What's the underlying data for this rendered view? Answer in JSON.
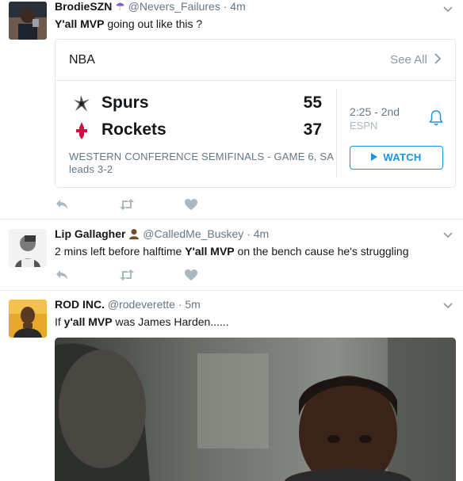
{
  "tweets": [
    {
      "fullname": "BrodieSZN",
      "name_emoji": "☂",
      "username": "@Nevers_Failures",
      "dot": "·",
      "time": "4m",
      "text_bold": "Y'all MVP",
      "text_rest": " going out like this ?"
    },
    {
      "fullname": "Lip Gallagher",
      "username": "@CalledMe_Buskey",
      "dot": "·",
      "time": "4m",
      "text_pre": "2 mins left before halftime ",
      "text_bold": "Y'all MVP",
      "text_rest": " on the bench cause he's struggling"
    },
    {
      "fullname": "ROD INC.",
      "username": "@rodeverette",
      "dot": "·",
      "time": "5m",
      "text_pre": "If ",
      "text_bold": "y'all MVP",
      "text_rest": " was James Harden......"
    }
  ],
  "score_card": {
    "league": "NBA",
    "see_all": "See All",
    "teams": [
      {
        "name": "Spurs",
        "score": "55"
      },
      {
        "name": "Rockets",
        "score": "37"
      }
    ],
    "series": "WESTERN CONFERENCE SEMIFINALS - GAME 6, SA leads 3-2",
    "clock": "2:25 - 2nd",
    "network": "ESPN",
    "watch_label": "WATCH"
  },
  "colors": {
    "link_blue": "#1b95e0",
    "muted_gray": "#657786",
    "icon_gray": "#aab8c2",
    "border": "#e1e8ed"
  },
  "icons": [
    "caret-down-icon",
    "reply-icon",
    "retweet-icon",
    "heart-icon",
    "spurs-logo-icon",
    "rockets-logo-icon",
    "bell-icon",
    "play-icon",
    "umbrella-emoji",
    "person-emoji"
  ]
}
